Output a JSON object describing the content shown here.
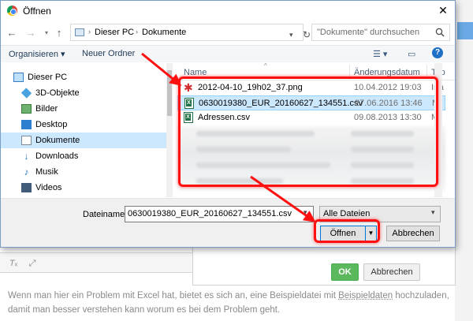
{
  "dialog": {
    "title": "Öffnen",
    "close_symbol": "✕"
  },
  "address_bar": {
    "segments": [
      "Dieser PC",
      "Dokumente"
    ],
    "search_placeholder": "\"Dokumente\" durchsuchen"
  },
  "toolbar": {
    "organize_label": "Organisieren",
    "new_folder_label": "Neuer Ordner",
    "help_symbol": "?"
  },
  "nav_pane": {
    "items": [
      {
        "label": "Dieser PC",
        "icon": "pc-icon"
      },
      {
        "label": "3D-Objekte",
        "icon": "cube-icon"
      },
      {
        "label": "Bilder",
        "icon": "pictures-icon"
      },
      {
        "label": "Desktop",
        "icon": "desktop-icon"
      },
      {
        "label": "Dokumente",
        "icon": "documents-icon",
        "selected": true
      },
      {
        "label": "Downloads",
        "icon": "download-icon"
      },
      {
        "label": "Musik",
        "icon": "music-icon"
      },
      {
        "label": "Videos",
        "icon": "video-icon"
      }
    ]
  },
  "file_list": {
    "columns": [
      "Name",
      "Änderungsdatum",
      "Typ"
    ],
    "rows": [
      {
        "name": "2012-04-10_19h02_37.png",
        "date": "10.04.2012 19:03",
        "type": "Irfa",
        "icon": "image-file-icon"
      },
      {
        "name": "0630019380_EUR_20160627_134551.csv",
        "date": "27.06.2016 13:46",
        "type": "Mi",
        "icon": "excel-file-icon",
        "selected": true
      },
      {
        "name": "Adressen.csv",
        "date": "09.08.2013 13:30",
        "type": "Mi",
        "icon": "excel-file-icon"
      }
    ]
  },
  "bottom": {
    "filename_label": "Dateiname:",
    "filename_value": "0630019380_EUR_20160627_134551.csv",
    "filetype_value": "Alle Dateien",
    "open_label": "Öffnen",
    "cancel_label": "Abbrechen"
  },
  "background_page": {
    "ok_label": "OK",
    "cancel_label": "Abbrechen",
    "text_before_link": "Wenn man hier ein Problem mit Excel hat, bietet es sich an, eine Beispieldatei mit ",
    "link_text": "Beispieldaten",
    "text_after_link": " hochzuladen, damit man besser verstehen kann worum es bei dem Problem geht."
  },
  "colors": {
    "highlight": "#ff1010",
    "selection": "#cce8ff",
    "accent": "#0078d7",
    "ok_green": "#5cb85c"
  }
}
